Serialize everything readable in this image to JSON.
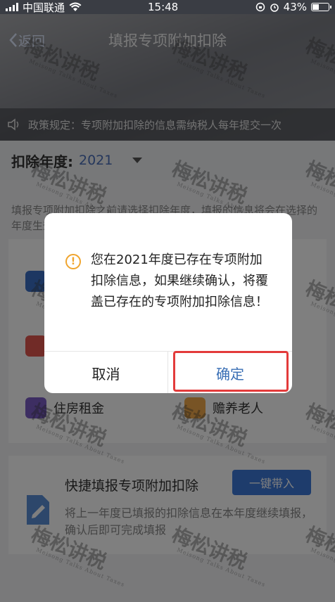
{
  "status_bar": {
    "carrier": "中国联通",
    "time": "15:48",
    "battery": "43%",
    "battery_fraction": 0.43
  },
  "nav": {
    "back_label": "返回",
    "title": "填报专项附加扣除"
  },
  "notice": {
    "text": "政策规定：专项附加扣除的信息需纳税人每年提交一次"
  },
  "year": {
    "label": "扣除年度:",
    "value": "2021"
  },
  "hint": {
    "text": "填报专项附加扣除之前请选择扣除年度，填报的信息将会在选择的年度生效"
  },
  "categories": [
    {
      "label": "",
      "color": "#3b6fc4"
    },
    {
      "label": "",
      "color": "#e2564e"
    },
    {
      "label": "住房租金",
      "color": "#7b5cc4"
    },
    {
      "label": "赡养老人",
      "color": "#f0a84a"
    }
  ],
  "quick": {
    "title": "快捷填报专项附加扣除",
    "button": "一键带入",
    "desc": "将上一年度已填报的扣除信息在本年度继续填报，确认后即可完成填报"
  },
  "dialog": {
    "message": "您在2021年度已存在专项附加扣除信息，如果继续确认，将覆盖已存在的专项附加扣除信息！",
    "cancel": "取消",
    "confirm": "确定"
  },
  "watermark": {
    "text": "梅松讲税",
    "sub": "Meisong Talks About Taxes"
  }
}
